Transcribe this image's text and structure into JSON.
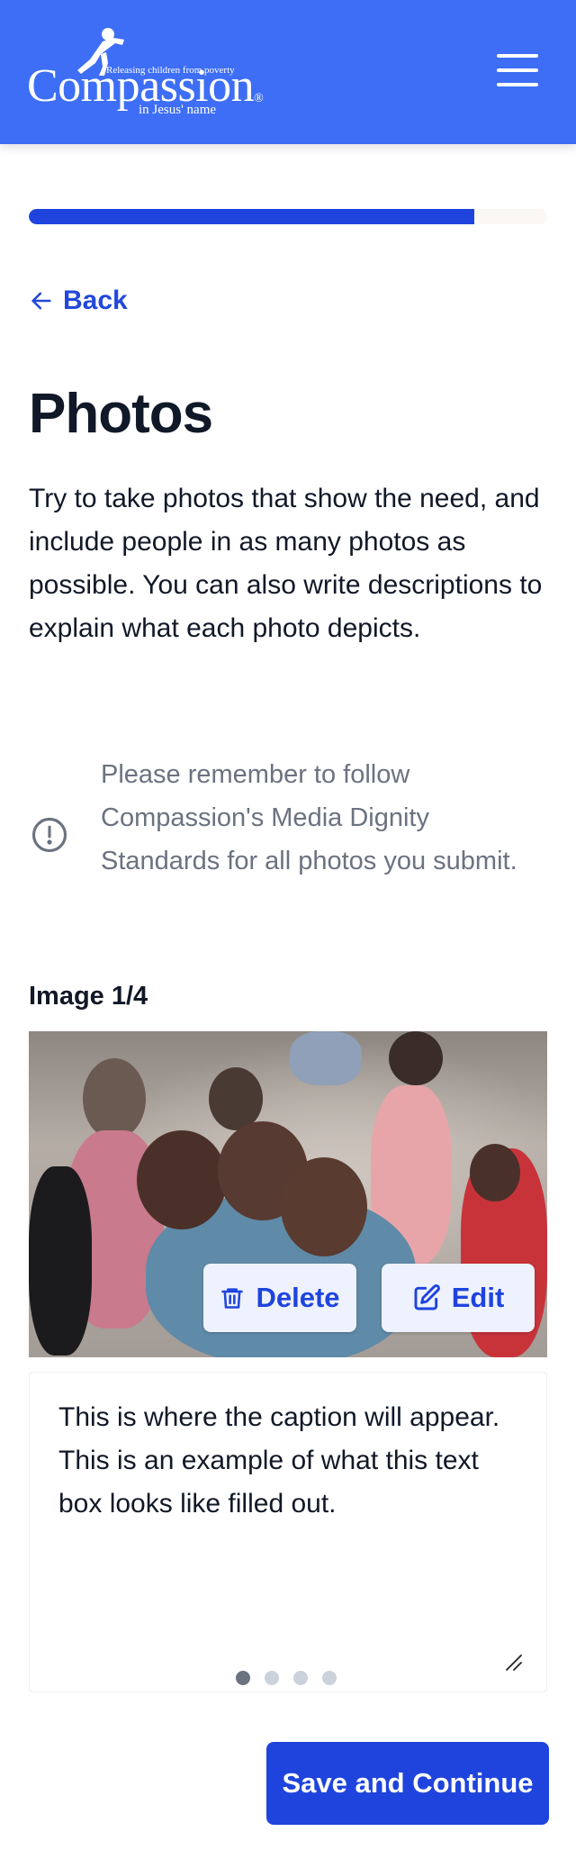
{
  "header": {
    "logo": {
      "tagline": "Releasing children from poverty",
      "wordmark": "Compassion",
      "registered": "®",
      "subline": "in Jesus' name"
    },
    "menu_icon": "hamburger-menu-icon"
  },
  "progress": {
    "value_fraction": 0.86
  },
  "nav": {
    "back_label": "Back",
    "back_icon": "arrow-left-icon"
  },
  "page": {
    "title": "Photos",
    "intro": "Try to take photos that show the need, and include people in as many photos as possible. You can also write descriptions to explain what each photo depicts."
  },
  "notice": {
    "icon": "exclamation-circle-icon",
    "text": "Please remember to follow Compassion's Media Dignity Standards for all photos you submit."
  },
  "image": {
    "label": "Image 1/4",
    "delete_label": "Delete",
    "delete_icon": "trash-icon",
    "edit_label": "Edit",
    "edit_icon": "edit-pencil-icon",
    "caption": "This is where the caption will appear. This is an example of what this text box looks like filled out."
  },
  "pagination": {
    "count": 4,
    "active_index": 0
  },
  "footer": {
    "save_label": "Save and Continue"
  },
  "colors": {
    "header_bg": "#3d6ef5",
    "primary": "#1f44dd",
    "link": "#2348db",
    "muted_text": "#6b7280"
  }
}
